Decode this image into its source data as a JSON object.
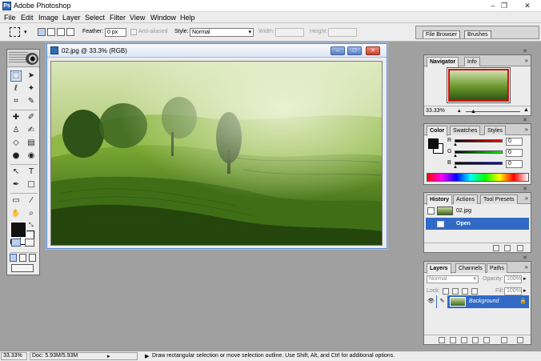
{
  "app": {
    "title": "Adobe Photoshop",
    "window_controls": {
      "minimize": "–",
      "restore": "❐",
      "close": "✕"
    }
  },
  "menu": [
    "File",
    "Edit",
    "Image",
    "Layer",
    "Select",
    "Filter",
    "View",
    "Window",
    "Help"
  ],
  "options_bar": {
    "feather_label": "Feather:",
    "feather_value": "0 px",
    "antialias_label": "Anti-aliased",
    "style_label": "Style:",
    "style_value": "Normal",
    "width_label": "Width:",
    "height_label": "Height:",
    "well_tabs": [
      "File Browser",
      "Brushes"
    ]
  },
  "toolbox": {
    "foreground_color": "#111111",
    "background_color": "#ffffff",
    "tools": [
      "rectangular-marquee-icon",
      "move-icon",
      "lasso-icon",
      "magic-wand-icon",
      "crop-icon",
      "slice-icon",
      "healing-brush-icon",
      "brush-icon",
      "clone-stamp-icon",
      "history-brush-icon",
      "eraser-icon",
      "gradient-icon",
      "blur-icon",
      "dodge-icon",
      "path-selection-icon",
      "type-icon",
      "pen-icon",
      "shape-icon",
      "notes-icon",
      "eyedropper-icon",
      "hand-icon",
      "zoom-icon"
    ]
  },
  "document": {
    "title": "02.jpg @ 33.3% (RGB)"
  },
  "navigator": {
    "tabs": [
      "Navigator",
      "Info"
    ],
    "zoom": "33.33%"
  },
  "color": {
    "tabs": [
      "Color",
      "Swatches",
      "Styles"
    ],
    "channels": [
      {
        "label": "R",
        "value": "0",
        "color": "#cc0000"
      },
      {
        "label": "G",
        "value": "0",
        "color": "#00a000"
      },
      {
        "label": "B",
        "value": "0",
        "color": "#0000cc"
      }
    ]
  },
  "history": {
    "tabs": [
      "History",
      "Actions",
      "Tool Presets"
    ],
    "snapshot": "02.jpg",
    "states": [
      "Open"
    ]
  },
  "layers": {
    "tabs": [
      "Layers",
      "Channels",
      "Paths"
    ],
    "blend_mode": "Normal",
    "opacity_label": "Opacity:",
    "opacity_value": "100%",
    "lock_label": "Lock:",
    "fill_label": "Fill:",
    "fill_value": "100%",
    "layer_name": "Background"
  },
  "status": {
    "zoom": "33.33%",
    "doc_size": "Doc: 5.93M/5.93M",
    "hint": "Draw rectangular selection or move selection outline. Use Shift, Alt, and Ctrl for additional options."
  },
  "colors": {
    "selection": "#316ac5",
    "doc_frame": "#5e8fd2",
    "workspace": "#a0a0a0"
  }
}
